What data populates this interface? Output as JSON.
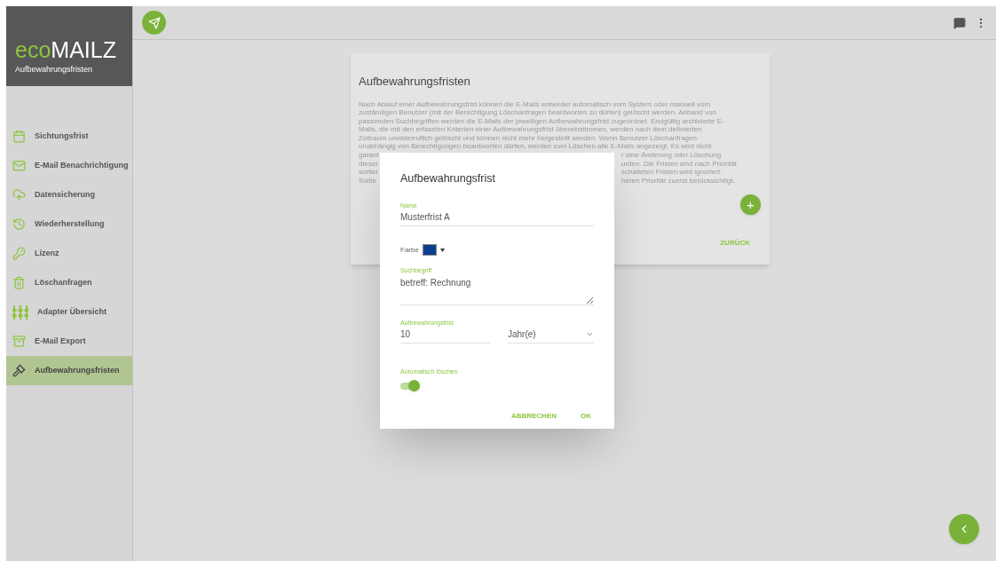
{
  "app": {
    "logo_prefix": "eco",
    "logo_suffix": "MAILZ",
    "subtitle": "Aufbewahrungsfristen"
  },
  "sidebar": {
    "items": [
      {
        "label": "Sichtungsfrist",
        "selected": false
      },
      {
        "label": "E-Mail Benachrichtigung",
        "selected": false
      },
      {
        "label": "Datensicherung",
        "selected": false
      },
      {
        "label": "Wiederherstellung",
        "selected": false
      },
      {
        "label": "Lizenz",
        "selected": false
      },
      {
        "label": "Löschanfragen",
        "selected": false
      },
      {
        "label": "Adapter Übersicht",
        "selected": false
      },
      {
        "label": "E-Mail Export",
        "selected": false
      },
      {
        "label": "Aufbewahrungsfristen",
        "selected": true
      }
    ]
  },
  "card": {
    "title": "Aufbewahrungsfristen",
    "lines": [
      {
        "left": "Nach Ablauf einer Aufbewahrungsfrist können die E-Mails entweder automatisch vom System oder manuell vom"
      },
      {
        "left": "zuständigen Benutzer (mit der Berechtigung Löschanfragen beantworten zu dürfen) gelöscht werden. Anhand von"
      },
      {
        "left": "passenden Suchbegriffen werden die E-Mails der jeweiligen Aufbewahrungsfrist zugeordnet. Endgültig archivierte E-"
      },
      {
        "left": "Mails, die mit den erfassten Kriterien einer Aufbewahrungsfrist übereinstimmen, werden nach dem definierten"
      },
      {
        "left": "Zeitraum unwiderruflich gelöscht und können nicht mehr hergestellt werden. Wenn Benutzer Löschanfragen"
      },
      {
        "left": "unabhängig von Berechtigungen beantworten dürfen, werden zum Löschen alle E-Mails angezeigt. Es wird nicht"
      },
      {
        "left": "garant",
        "right": "r eine Änderung oder Löschung"
      },
      {
        "left": "dieser",
        "right": "urden. Die Fristen sind nach Priorität"
      },
      {
        "left": "sortier",
        "right": "schalteten Fristen wird ignoriert."
      },
      {
        "left": "Sollte",
        "right": "heren Priorität zuerst berücksichtigt."
      }
    ],
    "add_button": "+",
    "back_button": "ZURÜCK"
  },
  "dialog": {
    "title": "Aufbewahrungsfrist",
    "name": {
      "label": "Name",
      "value": "Musterfrist A"
    },
    "color": {
      "label": "Farbe",
      "color": "#0d3f8f"
    },
    "search": {
      "label": "Suchbegriff",
      "value": "betreff: Rechnung"
    },
    "retention": {
      "label": "Aufbewahrungsfrist",
      "value": "10",
      "unit": "Jahr(e)"
    },
    "auto_delete": {
      "label": "Automatisch löschen",
      "on": true
    },
    "buttons": [
      "ABBRECHEN",
      "OK"
    ]
  }
}
